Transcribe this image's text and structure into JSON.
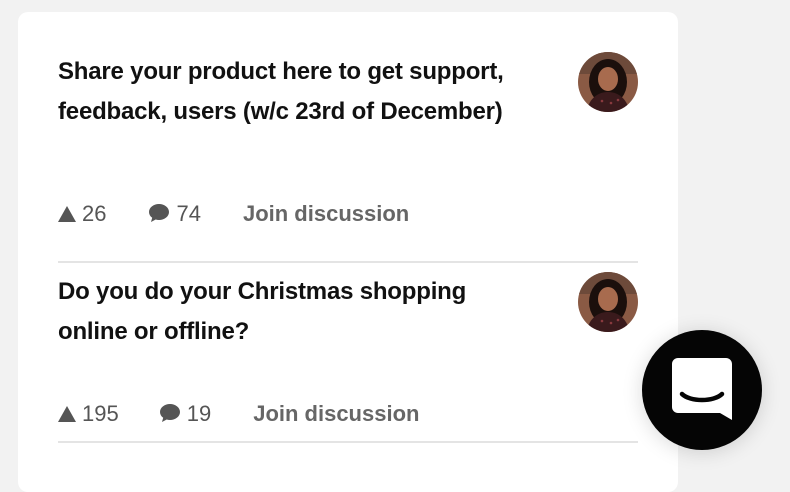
{
  "posts": [
    {
      "title": "Share your product here to get support, feedback, users (w/c 23rd of December)",
      "upvotes": "26",
      "comments": "74",
      "join_label": "Join discussion",
      "avatar_icon": "user-avatar"
    },
    {
      "title": "Do you do your Christmas shopping online or offline?",
      "upvotes": "195",
      "comments": "19",
      "join_label": "Join discussion",
      "avatar_icon": "user-avatar"
    }
  ],
  "icons": {
    "upvote": "triangle-up-icon",
    "comment": "speech-bubble-icon",
    "chat": "chat-launcher-icon"
  },
  "colors": {
    "page_bg": "#f2f2f2",
    "card_bg": "#ffffff",
    "title": "#111111",
    "meta": "#555555",
    "launcher_bg": "#050505"
  }
}
